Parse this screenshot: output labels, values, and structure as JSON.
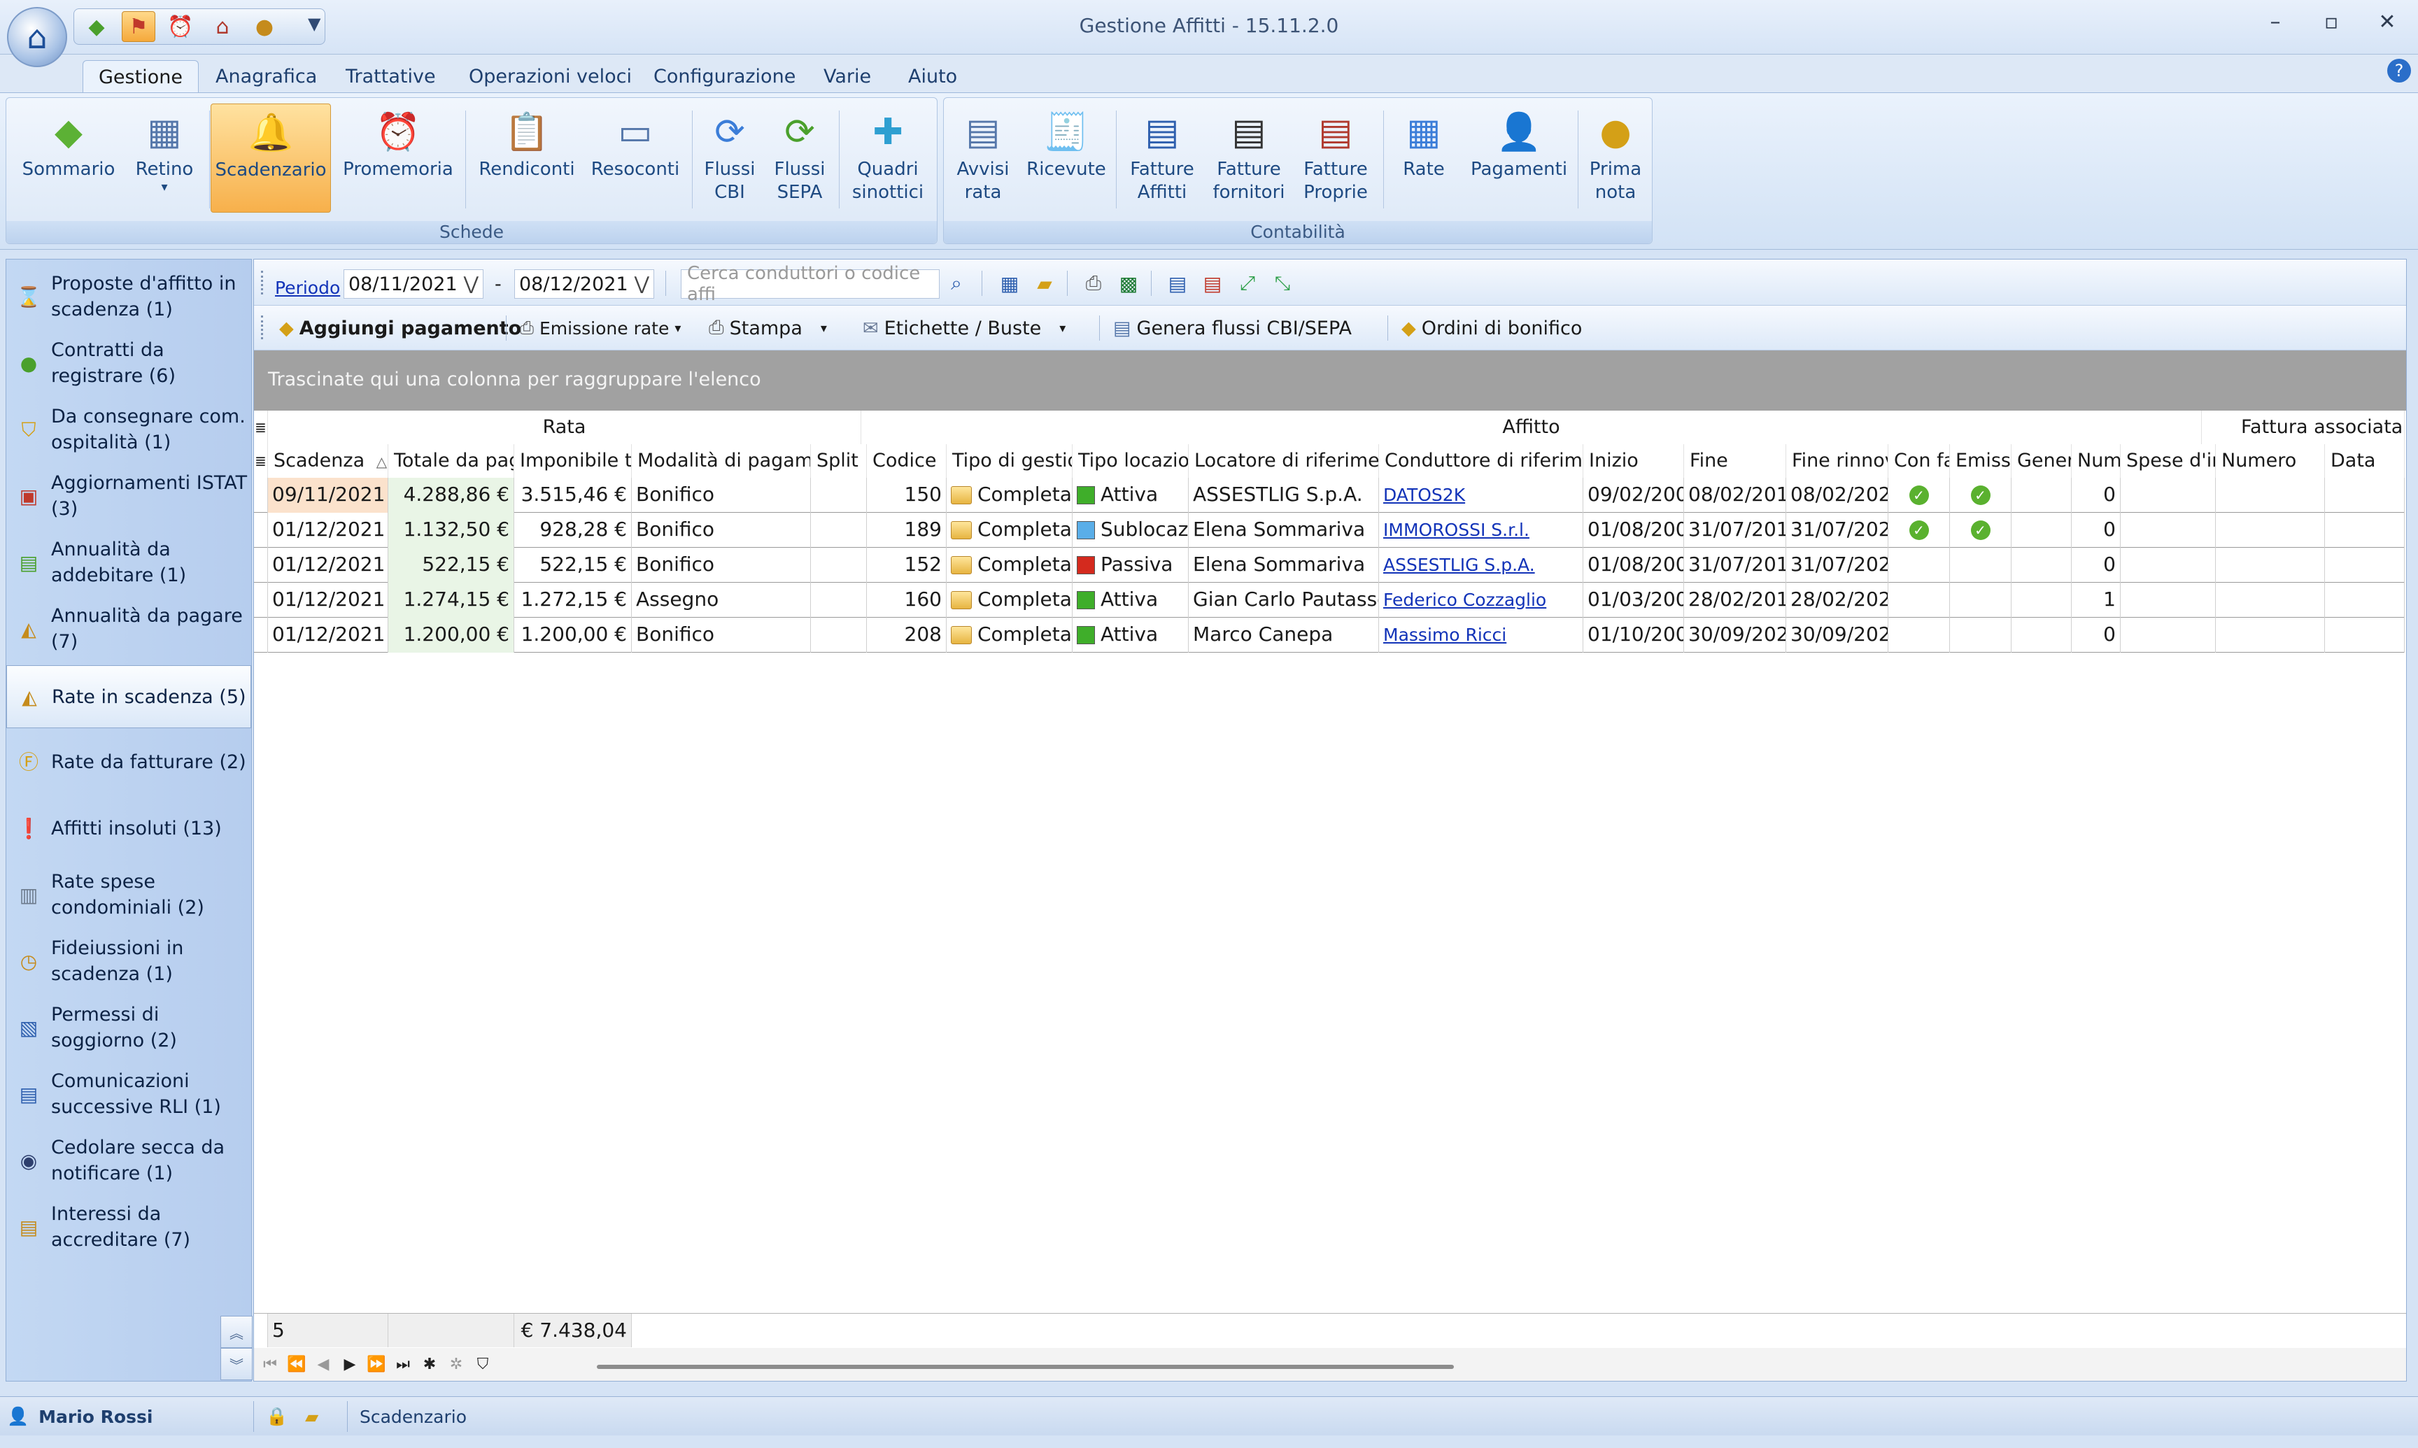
{
  "app": {
    "title": "Gestione Affitti - 15.11.2.0",
    "minimize": "–",
    "maximize": "▫",
    "close": "✕",
    "help": "?",
    "qat_dropdown": "▼"
  },
  "menu_tabs": [
    "Gestione",
    "Anagrafica",
    "Trattative",
    "Operazioni veloci",
    "Configurazione",
    "Varie",
    "Aiuto"
  ],
  "ribbon": {
    "schede_label": "Schede",
    "contabilita_label": "Contabilità",
    "buttons": {
      "sommario": "Sommario",
      "retino": "Retino",
      "scadenzario": "Scadenzario",
      "promemoria": "Promemoria",
      "rendiconti": "Rendiconti",
      "resoconti": "Resoconti",
      "flussi_cbi_1": "Flussi",
      "flussi_cbi_2": "CBI",
      "flussi_sepa_1": "Flussi",
      "flussi_sepa_2": "SEPA",
      "quadri_1": "Quadri",
      "quadri_2": "sinottici",
      "avvisi_1": "Avvisi",
      "avvisi_2": "rata",
      "ricevute": "Ricevute",
      "fatt_affitti_1": "Fatture",
      "fatt_affitti_2": "Affitti",
      "fatt_fornitori_1": "Fatture",
      "fatt_fornitori_2": "fornitori",
      "fatt_proprie_1": "Fatture",
      "fatt_proprie_2": "Proprie",
      "rate": "Rate",
      "pagamenti": "Pagamenti",
      "prima_1": "Prima",
      "prima_2": "nota"
    }
  },
  "sidebar": {
    "items": [
      {
        "l1": "Proposte d'affitto in",
        "l2": "scadenza (1)"
      },
      {
        "l1": "Contratti da",
        "l2": "registrare (6)"
      },
      {
        "l1": "Da consegnare com.",
        "l2": "ospitalità (1)"
      },
      {
        "l1": "Aggiornamenti ISTAT",
        "l2": "(3)"
      },
      {
        "l1": "Annualità da",
        "l2": "addebitare (1)"
      },
      {
        "l1": "Annualità da pagare",
        "l2": "(7)"
      },
      {
        "l1": "Rate in scadenza (5)",
        "l2": ""
      },
      {
        "l1": "Rate da fatturare (2)",
        "l2": ""
      },
      {
        "l1": "Affitti insoluti (13)",
        "l2": ""
      },
      {
        "l1": "Rate spese",
        "l2": "condominiali (2)"
      },
      {
        "l1": "Fideiussioni in",
        "l2": "scadenza (1)"
      },
      {
        "l1": "Permessi di",
        "l2": "soggiorno (2)"
      },
      {
        "l1": "Comunicazioni",
        "l2": "successive RLI (1)"
      },
      {
        "l1": "Cedolare secca da",
        "l2": "notificare (1)"
      },
      {
        "l1": "Interessi da",
        "l2": "accreditare (7)"
      }
    ]
  },
  "toolbar": {
    "periodo": "Periodo",
    "date_from": "08/11/2021",
    "date_sep": "-",
    "date_to": "08/12/2021",
    "dd": "⋁",
    "search_placeholder": "Cerca conduttori o codice affi",
    "aggiungi": "Aggiungi pagamento",
    "emissione": "Emissione rate",
    "stampa": "Stampa",
    "etichette": "Etichette / Buste",
    "genera": "Genera flussi CBI/SEPA",
    "ordini": "Ordini di bonifico"
  },
  "group_hint": "Trascinate qui una colonna per raggruppare l'elenco",
  "bands": {
    "rata": "Rata",
    "affitto": "Affitto",
    "fattura": "Fattura associata"
  },
  "columns": {
    "scadenza": "Scadenza",
    "sort_glyph": "△",
    "totale": "Totale da pag",
    "imponibile": "Imponibile t",
    "modalita": "Modalità di pagame",
    "split": "Split |",
    "codice": "Codice",
    "tipo_gest": "Tipo di gestio",
    "tipo_loc": "Tipo locazior",
    "locatore": "Locatore di riferimen",
    "conduttore": "Conduttore di riferimer",
    "inizio": "Inizio",
    "fine": "Fine",
    "fine_rinnovo": "Fine rinnov",
    "con_fa": "Con fa",
    "emissi": "Emissi",
    "gener": "Gener",
    "num": "Num",
    "spese": "Spese d'ir",
    "numero": "Numero",
    "data": "Data"
  },
  "rows": [
    {
      "scadenza": "09/11/2021",
      "totale": "4.288,86 €",
      "imponibile": "3.515,46 €",
      "modalita": "Bonifico",
      "codice": "150",
      "tipo_gest": "Completa",
      "tipo_loc": "Attiva",
      "loc_color": "#3fae2a",
      "locatore": "ASSESTLIG S.p.A.",
      "conduttore": "DATOS2K",
      "inizio": "09/02/200",
      "fine": "08/02/201",
      "fine_rinnovo": "08/02/202",
      "con_fa": "✓",
      "emissi": "✓",
      "num": "0"
    },
    {
      "scadenza": "01/12/2021",
      "totale": "1.132,50 €",
      "imponibile": "928,28 €",
      "modalita": "Bonifico",
      "codice": "189",
      "tipo_gest": "Completa",
      "tipo_loc": "Sublocaz",
      "loc_color": "#5aaee8",
      "locatore": "Elena Sommariva",
      "conduttore": "IMMOROSSI S.r.l.",
      "inizio": "01/08/200",
      "fine": "31/07/201",
      "fine_rinnovo": "31/07/202",
      "con_fa": "✓",
      "emissi": "✓",
      "num": "0"
    },
    {
      "scadenza": "01/12/2021",
      "totale": "522,15 €",
      "imponibile": "522,15 €",
      "modalita": "Bonifico",
      "codice": "152",
      "tipo_gest": "Completa",
      "tipo_loc": "Passiva",
      "loc_color": "#d42a1e",
      "locatore": "Elena Sommariva",
      "conduttore": "ASSESTLIG S.p.A.",
      "inizio": "01/08/200",
      "fine": "31/07/201",
      "fine_rinnovo": "31/07/202",
      "con_fa": "",
      "emissi": "",
      "num": "0"
    },
    {
      "scadenza": "01/12/2021",
      "totale": "1.274,15 €",
      "imponibile": "1.272,15 €",
      "modalita": "Assegno",
      "codice": "160",
      "tipo_gest": "Completa",
      "tipo_loc": "Attiva",
      "loc_color": "#3fae2a",
      "locatore": "Gian Carlo Pautasso",
      "conduttore": "Federico Cozzaglio",
      "inizio": "01/03/200",
      "fine": "28/02/201",
      "fine_rinnovo": "28/02/202",
      "con_fa": "",
      "emissi": "",
      "num": "1"
    },
    {
      "scadenza": "01/12/2021",
      "totale": "1.200,00 €",
      "imponibile": "1.200,00 €",
      "modalita": "Bonifico",
      "codice": "208",
      "tipo_gest": "Completa",
      "tipo_loc": "Attiva",
      "loc_color": "#3fae2a",
      "locatore": "Marco Canepa",
      "conduttore": "Massimo Ricci",
      "inizio": "01/10/200",
      "fine": "30/09/202",
      "fine_rinnovo": "30/09/202",
      "con_fa": "",
      "emissi": "",
      "num": "0"
    }
  ],
  "footer": {
    "count": "5",
    "total": "€ 7.438,04"
  },
  "statusbar": {
    "user": "Mario Rossi",
    "section": "Scadenzario"
  }
}
